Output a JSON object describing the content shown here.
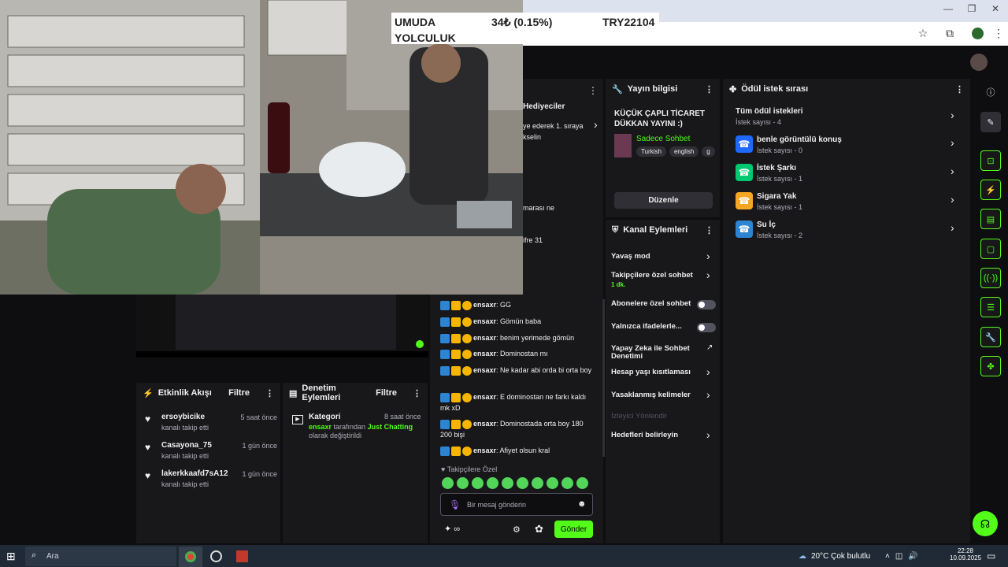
{
  "browser": {
    "minimize": "—",
    "restore": "❐",
    "close": "✕"
  },
  "ticker": {
    "line1_left": "UMUDA",
    "line1_mid": "34₺ (0.15%)",
    "line1_right": "TRY22104",
    "line2_left": "YOLCULUK"
  },
  "behind_panel": {
    "title": "Hediyeciler",
    "text1": "ye ederek 1. sıraya",
    "text2": "kselin",
    "text3": "marası ne",
    "text4": "ifre 31"
  },
  "stream_info": {
    "title": "Yayın bilgisi",
    "stream_title": "KÜÇÜK ÇAPLI TİCARET DÜKKAN YAYINI :)",
    "category": "Sadece Sohbet",
    "tags": [
      "Turkish",
      "english",
      "g"
    ],
    "edit_button": "Düzenle"
  },
  "channel_actions": {
    "title": "Kanal Eylemleri",
    "items": [
      {
        "label": "Yavaş mod",
        "kind": "chevron"
      },
      {
        "label": "Takipçilere özel sohbet",
        "sub": "1 dk.",
        "kind": "chevron"
      },
      {
        "label": "Abonelere özel sohbet",
        "kind": "toggle"
      },
      {
        "label": "Yalnızca ifadelerle...",
        "kind": "toggle"
      },
      {
        "label": "Yapay Zeka ile Sohbet Denetimi",
        "kind": "external"
      },
      {
        "label": "Hesap yaşı kısıtlaması",
        "kind": "chevron"
      },
      {
        "label": "Yasaklanmış kelimeler",
        "kind": "chevron"
      },
      {
        "label": "İzleyici Yönlendir",
        "kind": "disabled"
      },
      {
        "label": "Hedefleri belirleyin",
        "kind": "chevron"
      }
    ]
  },
  "rewards": {
    "title": "Ödül istek sırası",
    "all_label": "Tüm ödül istekleri",
    "all_count": "İstek sayısı - 4",
    "items": [
      {
        "label": "benle görüntülü konuş",
        "count": "İstek sayısı - 0",
        "color": "#1f69ff",
        "icon": "☎"
      },
      {
        "label": "İstek Şarkı",
        "count": "İstek sayısı - 1",
        "color": "#00c86f",
        "icon": "☎"
      },
      {
        "label": "Sigara Yak",
        "count": "İstek sayısı - 1",
        "color": "#f5a623",
        "icon": "☎"
      },
      {
        "label": "Su İç",
        "count": "İstek sayısı - 2",
        "color": "#2d84d0",
        "icon": "☎"
      }
    ]
  },
  "activity": {
    "title": "Etkinlik Akışı",
    "filter": "Filtre",
    "items": [
      {
        "user": "ersoybicike",
        "action": "kanalı takip etti",
        "time": "5 saat önce"
      },
      {
        "user": "Casayona_75",
        "action": "kanalı takip etti",
        "time": "1 gün önce"
      },
      {
        "user": "lakerkkaafd7sA12",
        "action": "kanalı takip etti",
        "time": "1 gün önce"
      }
    ]
  },
  "moderation": {
    "title": "Denetim Eylemleri",
    "filter": "Filtre",
    "item_title": "Kategori",
    "item_time": "8 saat önce",
    "item_user": "ensaxr",
    "item_mid": " tarafından ",
    "item_cat": "Just Chatting",
    "item_end": "olarak değiştirildi"
  },
  "chat": {
    "messages": [
      {
        "user": "ensaxr",
        "text": "GG"
      },
      {
        "user": "ensaxr",
        "text": "Gömün baba"
      },
      {
        "user": "ensaxr",
        "text": "benim yerimede gömün"
      },
      {
        "user": "ensaxr",
        "text": "Dominostan mı"
      },
      {
        "user": "ensaxr",
        "text": "Ne kadar abi orda bi orta boy"
      },
      {
        "user": "ensaxr",
        "text": "E dominostan ne farkı kaldı mk xD"
      },
      {
        "user": "ensaxr",
        "text": "Dominostada orta boy 180 200 bişi"
      },
      {
        "user": "ensaxr",
        "text": "Afiyet olsun kral"
      }
    ],
    "followers_only": "Takipçilere Özel",
    "placeholder": "Bir mesaj gönderin",
    "points": "∞",
    "send": "Gönder"
  },
  "taskbar": {
    "search": "Ara",
    "weather": "20°C  Çok bulutlu",
    "time": "22:28",
    "date": "10.09.2025"
  },
  "colors": {
    "accent_green": "#53fc18",
    "panel": "#18181b",
    "background": "#0e0e10"
  }
}
